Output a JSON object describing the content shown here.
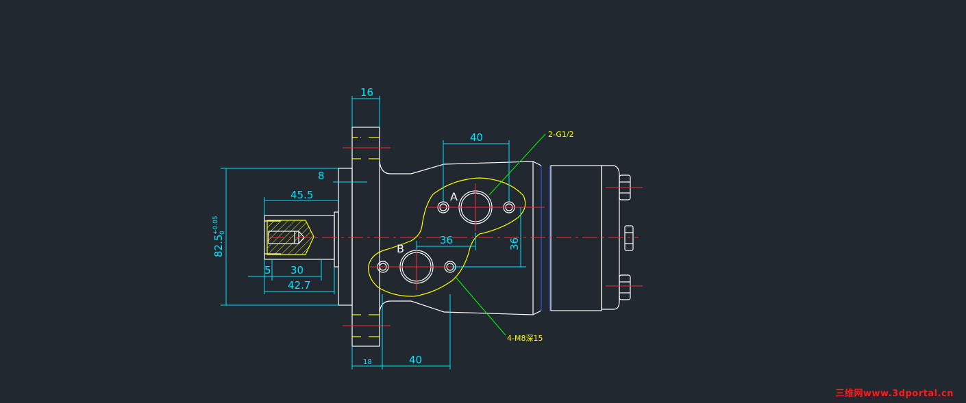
{
  "drawing": {
    "dimensions": {
      "flange_width": "16",
      "port_spacing_x": "40",
      "shaft_offset": "8",
      "shaft_length": "45.5",
      "key_length": "30",
      "key_offset": "5",
      "shaft_total": "42.7",
      "pilot_diameter": "82.5",
      "pilot_tol_upper": "+0.05",
      "pilot_tol_lower": "0",
      "bolt_spacing_x": "36",
      "bolt_spacing_y": "36",
      "bottom_offset": "18",
      "bottom_spacing": "40"
    },
    "labels": {
      "port_a": "A",
      "port_b": "B"
    },
    "callouts": {
      "ports": "2-G1/2",
      "bolts": "4-M8深15"
    }
  },
  "watermark": "三维网www.3dportal.cn",
  "colors": {
    "background": "#212830",
    "outline": "#ffffff",
    "dimension": "#00e5ff",
    "centerline": "#ff2a2a",
    "flange_face": "#ffff00",
    "leader": "#00ff00"
  }
}
